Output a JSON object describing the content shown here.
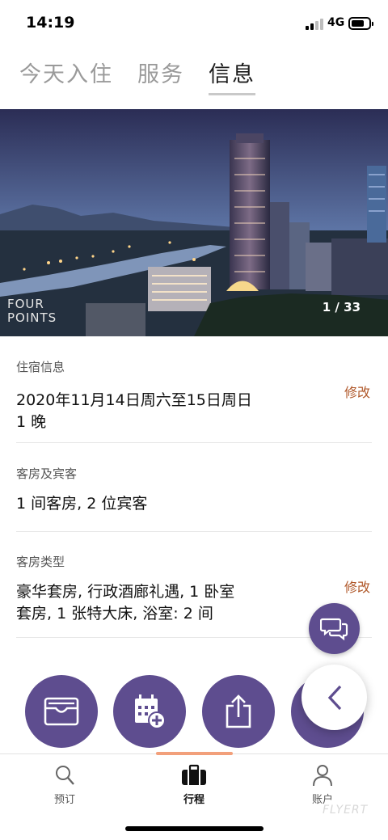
{
  "status_bar": {
    "time": "14:19",
    "network": "4G"
  },
  "tabs": [
    {
      "label": "今天入住",
      "active": false
    },
    {
      "label": "服务",
      "active": false
    },
    {
      "label": "信息",
      "active": true
    }
  ],
  "hero": {
    "brand_line1": "FOUR",
    "brand_line2": "POINTS",
    "photo_counter": "1 / 33"
  },
  "stay_info": {
    "label": "住宿信息",
    "dates": "2020年11月14日周六至15日周日",
    "nights": "1 晚",
    "edit_label": "修改"
  },
  "rooms_guests": {
    "label": "客房及宾客",
    "value": "1 间客房, 2 位宾客"
  },
  "room_type": {
    "label": "客房类型",
    "line1": "豪华套房, 行政酒廊礼遇, 1 卧室",
    "line2": "套房, 1  张特大床, 浴室: 2 间",
    "edit_label": "修改"
  },
  "bottom_nav": [
    {
      "label": "预订",
      "icon": "search-icon",
      "active": false
    },
    {
      "label": "行程",
      "icon": "suitcase-icon",
      "active": true
    },
    {
      "label": "账户",
      "icon": "person-icon",
      "active": false
    }
  ],
  "watermark": "FLYERT",
  "colors": {
    "accent": "#5e4d8f",
    "edit": "#b0582a",
    "indicator": "#f2a07b"
  }
}
